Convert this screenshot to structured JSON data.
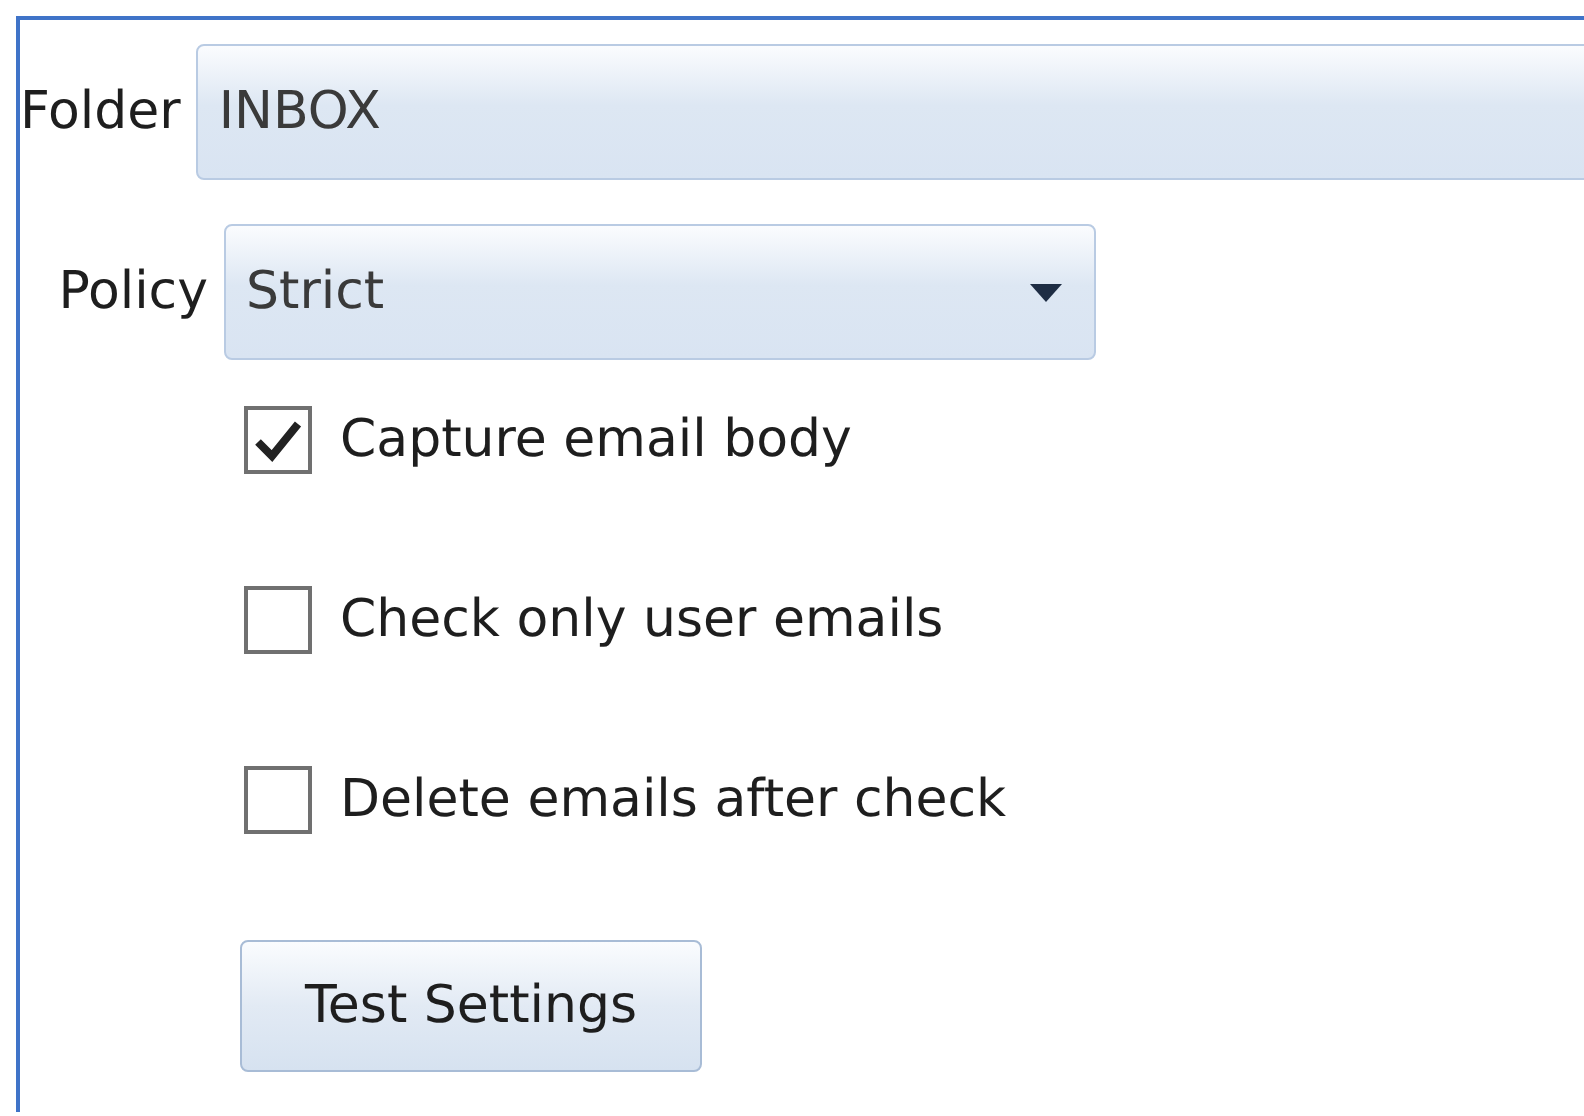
{
  "folder": {
    "label": "Folder",
    "value": "INBOX"
  },
  "policy": {
    "label": "Policy",
    "value": "Strict"
  },
  "options": [
    {
      "label": "Capture email body",
      "checked": true
    },
    {
      "label": "Check only user emails",
      "checked": false
    },
    {
      "label": "Delete emails after check",
      "checked": false
    }
  ],
  "button": "Test Settings"
}
